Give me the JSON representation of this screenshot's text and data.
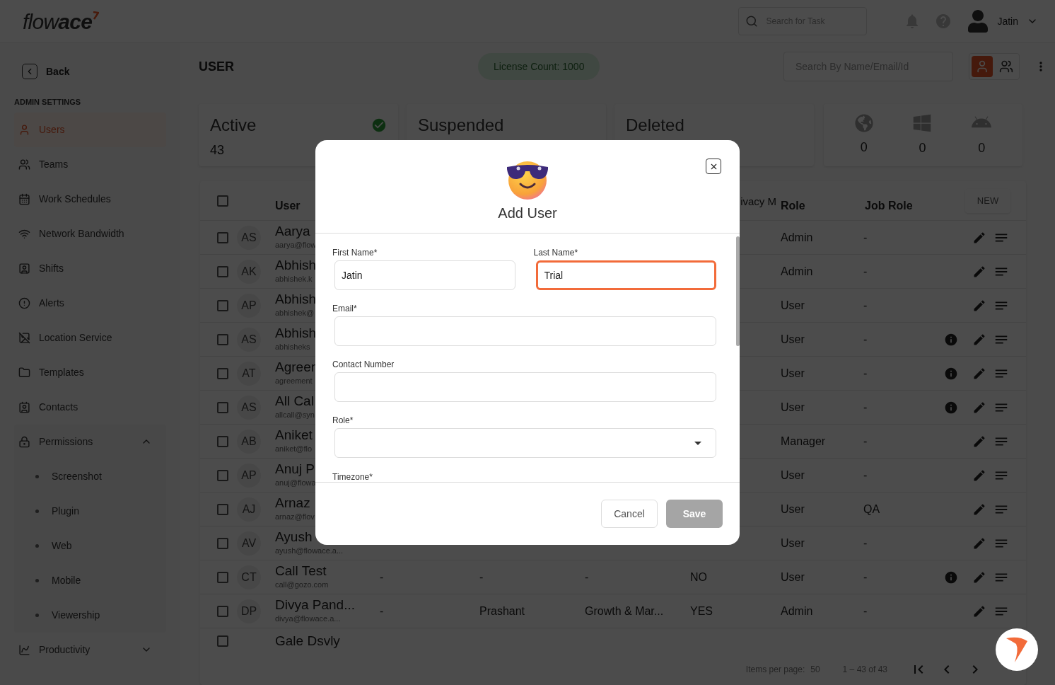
{
  "app": {
    "logo": "flow**ace**",
    "search": {
      "placeholder": "Search for Task"
    },
    "user_name": "Jatin"
  },
  "sidebar": {
    "back": "Back",
    "section": "ADMIN SETTINGS",
    "items": [
      {
        "label": "Users",
        "selected": true
      },
      {
        "label": "Teams",
        "selected": false
      },
      {
        "label": "Work Schedules",
        "selected": false
      },
      {
        "label": "Network Bandwidth",
        "selected": false
      },
      {
        "label": "Shifts",
        "selected": false
      },
      {
        "label": "Alerts",
        "selected": false
      },
      {
        "label": "Location Service",
        "selected": false
      },
      {
        "label": "Templates",
        "selected": false
      },
      {
        "label": "Contacts",
        "selected": false
      },
      {
        "label": "Permissions",
        "selected": false,
        "expanded": true,
        "children": [
          {
            "label": "Screenshot"
          },
          {
            "label": "Plugin"
          },
          {
            "label": "Web"
          },
          {
            "label": "Mobile"
          },
          {
            "label": "Viewership"
          }
        ]
      },
      {
        "label": "Productivity",
        "selected": false,
        "expanded": false
      }
    ]
  },
  "page": {
    "title": "USER",
    "license": "License Count: 1000",
    "search": {
      "placeholder": "Search By Name/Email/Id"
    },
    "views": [
      {
        "selected": true
      },
      {
        "selected": false
      }
    ]
  },
  "status_cards": [
    {
      "label": "Active",
      "count": "43",
      "check": true
    },
    {
      "label": "Suspended",
      "check": false
    },
    {
      "label": "Deleted",
      "check": false
    }
  ],
  "platforms": [
    {
      "kind": "web",
      "count": "0"
    },
    {
      "kind": "windows",
      "count": "0"
    },
    {
      "kind": "android",
      "count": "0"
    }
  ],
  "table": {
    "all_checked": false,
    "columns": {
      "user": "User",
      "column_7": "ivacy M",
      "role": "Role",
      "job_role": "Job Role"
    },
    "new_button": "NEW",
    "rows": [
      {
        "checked": false,
        "initials": "AS",
        "name": "Aarya",
        "email": "aarya@flow",
        "role": "Admin",
        "job_role": "-",
        "info": false
      },
      {
        "checked": false,
        "initials": "AK",
        "name": "Abhish",
        "email": "abhishek.k",
        "role": "Admin",
        "job_role": "-",
        "info": false
      },
      {
        "checked": false,
        "initials": "AP",
        "name": "Abhish",
        "email": "abhishek@",
        "role": "User",
        "job_role": "-",
        "info": false
      },
      {
        "checked": false,
        "initials": "AS",
        "name": "Abhish",
        "email": "abhisheks",
        "role": "User",
        "job_role": "-",
        "info": true
      },
      {
        "checked": false,
        "initials": "AT",
        "name": "Agreer",
        "email": "agreement",
        "role": "User",
        "job_role": "-",
        "info": true
      },
      {
        "checked": false,
        "initials": "AS",
        "name": "All Cal",
        "email": "allcall@syn",
        "role": "User",
        "job_role": "-",
        "info": true
      },
      {
        "checked": false,
        "initials": "AB",
        "name": "Aniket",
        "email": "aniket@flo",
        "role": "Manager",
        "job_role": "-",
        "info": false
      },
      {
        "checked": false,
        "initials": "AP",
        "name": "Anuj P",
        "email": "anuj@flowa",
        "role": "User",
        "job_role": "-",
        "info": false
      },
      {
        "checked": false,
        "initials": "AJ",
        "name": "Arnaz",
        "email": "arnaz@flov",
        "role": "User",
        "job_role": "QA",
        "info": false
      },
      {
        "checked": false,
        "initials": "AV",
        "name": "Ayush",
        "email": "ayush@flowace.a...",
        "role": "User",
        "job_role": "-",
        "info": false
      },
      {
        "checked": false,
        "initials": "CT",
        "name": "Call Test",
        "email": "call@gozo.com",
        "column_4": "-",
        "column_5": "-",
        "column_6": "-",
        "column_7": "NO",
        "role": "User",
        "job_role": "-",
        "info": true
      },
      {
        "checked": false,
        "initials": "DP",
        "name": "Divya Pand...",
        "email": "divya@flowace.a...",
        "column_4": "-",
        "column_5": "Prashant",
        "column_6": "Growth & Mar...",
        "column_7": "YES",
        "role": "Admin",
        "job_role": "-",
        "info": false
      },
      {
        "checked": false,
        "name": "Gale Dsvly",
        "info": false
      }
    ],
    "footer": {
      "items_per_page": "Items per page:",
      "page_size": "50",
      "range": "1 – 43 of 43"
    }
  },
  "dialog": {
    "title": "Add User",
    "fields": [
      {
        "label": "First Name*",
        "kind": "text",
        "value": "Jatin",
        "focused": false
      },
      {
        "label": "Last Name*",
        "kind": "text",
        "value": "Trial",
        "focused": true
      },
      {
        "label": "Email*",
        "kind": "text",
        "focused": false
      },
      {
        "label": "Contact Number",
        "kind": "text",
        "focused": false
      },
      {
        "label": "Role*",
        "kind": "select",
        "focused": false
      }
    ],
    "cut_label": "Timezone*",
    "cancel": "Cancel",
    "save": "Save",
    "save_disabled": true
  }
}
